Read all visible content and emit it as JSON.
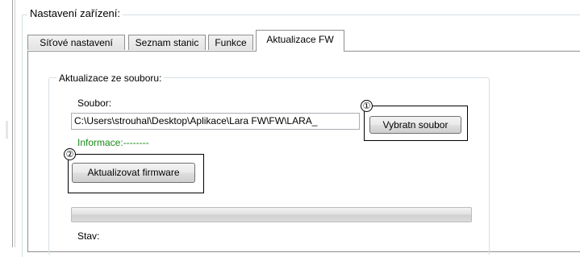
{
  "device_settings": {
    "title": "Nastavení zařízení:",
    "tabs": [
      {
        "label": "Síťové nastavení"
      },
      {
        "label": "Seznam stanic"
      },
      {
        "label": "Funkce"
      },
      {
        "label": "Aktualizace FW",
        "active": true
      }
    ]
  },
  "file_update": {
    "group_title": "Aktualizace ze souboru:",
    "file_label": "Soubor:",
    "file_path": "C:\\Users\\strouhal\\Desktop\\Aplikace\\Lara FW\\FW\\LARA_",
    "choose_button": "Vybratn soubor",
    "info_text": "Informace:--------",
    "update_button": "Aktualizovat firmware",
    "progress": 0,
    "state_label": "Stav:"
  },
  "annotations": [
    "①",
    "②"
  ],
  "colors": {
    "info_text": "#1a8a1a",
    "border": "#8e8f8f"
  }
}
